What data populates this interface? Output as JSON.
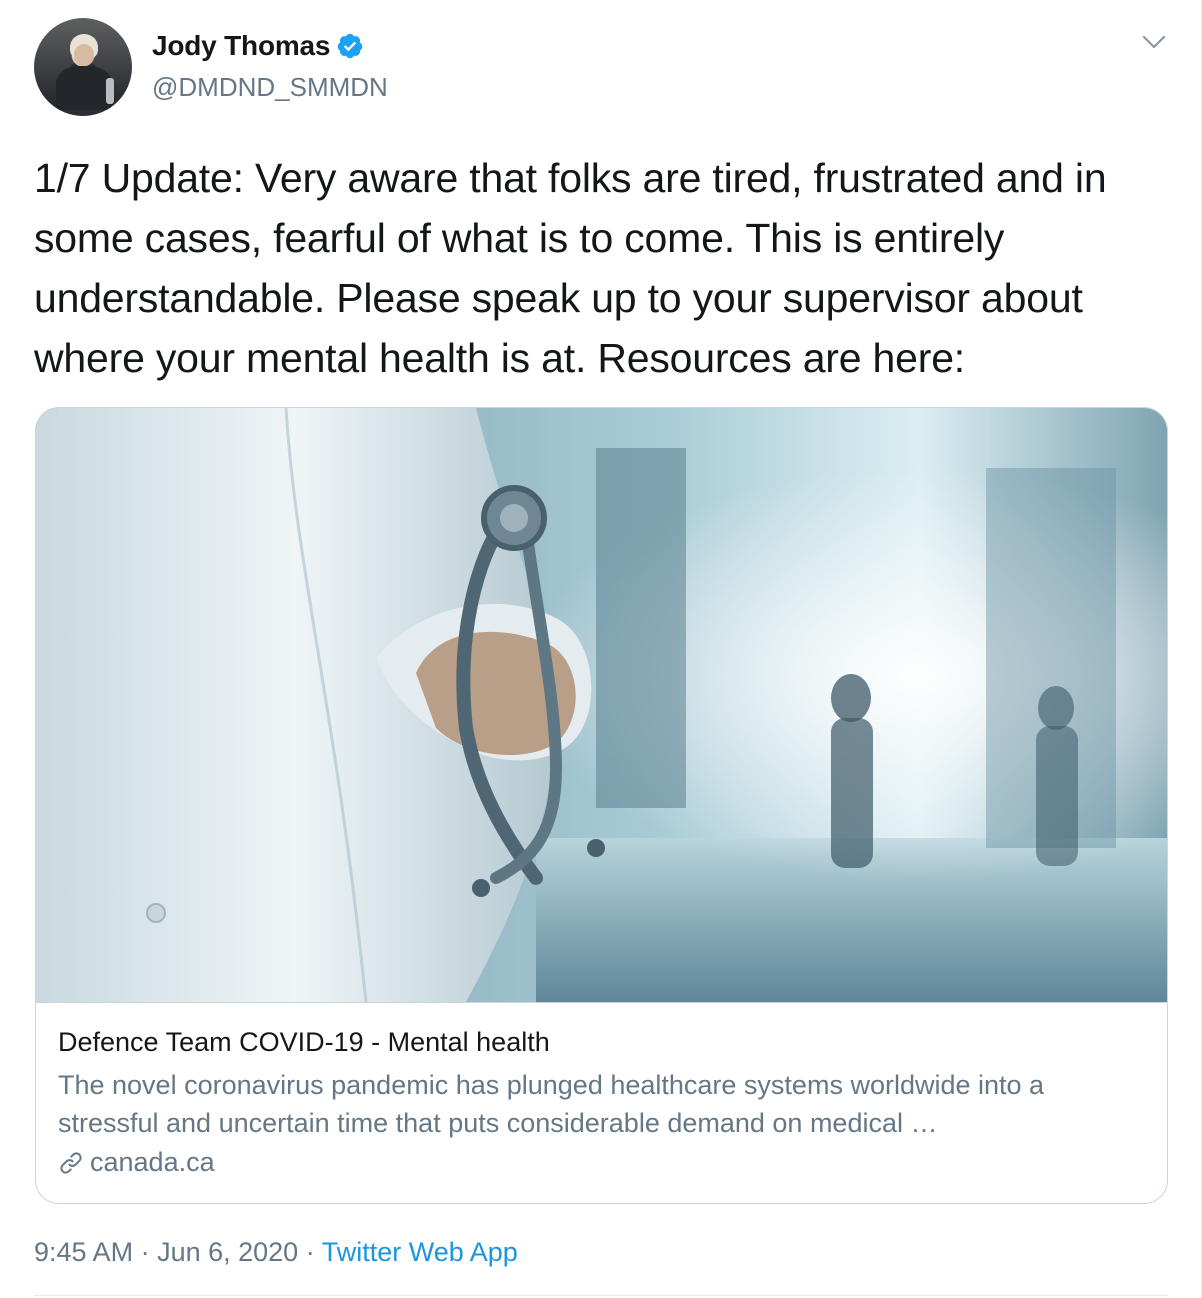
{
  "author": {
    "display_name": "Jody Thomas",
    "handle": "@DMDND_SMMDN",
    "verified": true
  },
  "tweet": {
    "text": "1/7 Update: Very aware that folks are tired, frustrated and in some cases, fearful of what is to come. This is entirely understandable. Please speak up to your supervisor about where your mental health is at. Resources are here:"
  },
  "card": {
    "title": "Defence Team COVID-19 - Mental health",
    "description": "The novel coronavirus pandemic has plunged healthcare systems worldwide into a stressful and uncertain time that puts considerable demand on medical …",
    "domain": "canada.ca"
  },
  "meta": {
    "time": "9:45 AM",
    "separator": " · ",
    "date": "Jun 6, 2020",
    "source": "Twitter Web App"
  },
  "icons": {
    "verified": "verified-badge-icon",
    "caret": "chevron-down-icon",
    "link": "link-icon"
  },
  "colors": {
    "accent": "#1b95e0",
    "verified_badge": "#1da1f2",
    "secondary_text": "#657786",
    "border": "#ccd6dd"
  }
}
